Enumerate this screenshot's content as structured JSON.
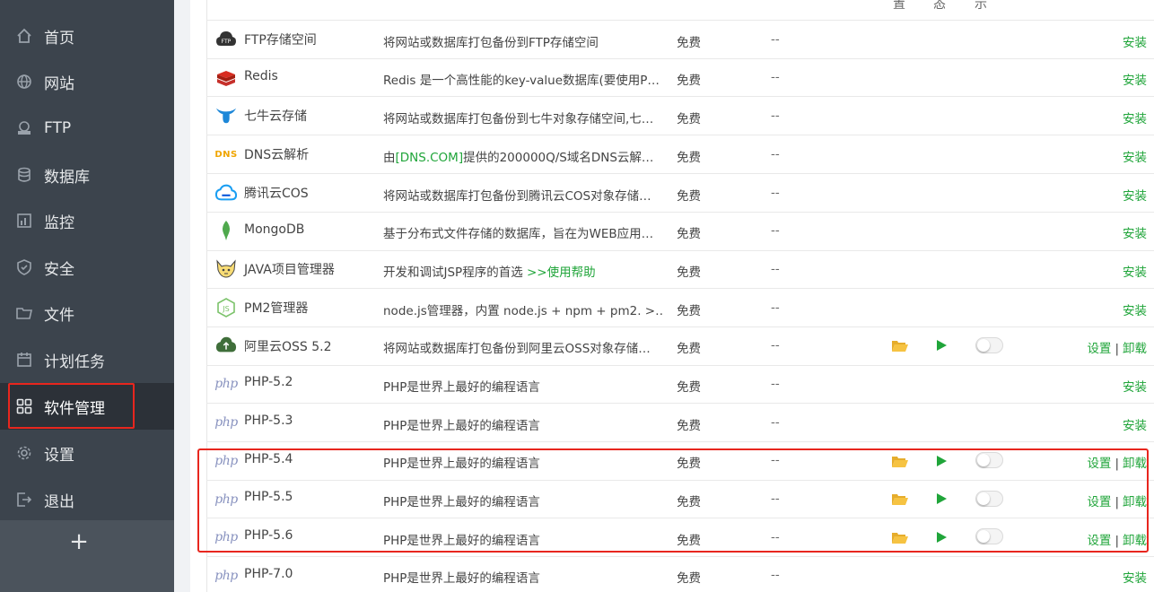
{
  "sidebar": {
    "items": [
      {
        "label": "首页",
        "icon": "home-icon"
      },
      {
        "label": "网站",
        "icon": "globe-icon"
      },
      {
        "label": "FTP",
        "icon": "ftp-icon"
      },
      {
        "label": "数据库",
        "icon": "database-icon"
      },
      {
        "label": "监控",
        "icon": "monitor-icon"
      },
      {
        "label": "安全",
        "icon": "shield-icon"
      },
      {
        "label": "文件",
        "icon": "folder-icon"
      },
      {
        "label": "计划任务",
        "icon": "calendar-icon"
      },
      {
        "label": "软件管理",
        "icon": "apps-grid-icon",
        "active": true
      },
      {
        "label": "设置",
        "icon": "gear-icon"
      },
      {
        "label": "退出",
        "icon": "logout-icon"
      }
    ],
    "add_label": "+"
  },
  "table": {
    "header_fragments": [
      "置",
      "态",
      "示"
    ],
    "rows": [
      {
        "name": "FTP存储空间",
        "icon": "ftp-cloud-icon",
        "desc": "将网站或数据库打包备份到FTP存储空间",
        "price": "免费",
        "expire": "--",
        "installed": false,
        "op": "安装"
      },
      {
        "name": "Redis",
        "icon": "redis-icon",
        "desc": "Redis 是一个高性能的key-value数据库(要使用P…",
        "price": "免费",
        "expire": "--",
        "installed": false,
        "op": "安装"
      },
      {
        "name": "七牛云存储",
        "icon": "qiniu-icon",
        "desc": "将网站或数据库打包备份到七牛对象存储空间,七…",
        "price": "免费",
        "expire": "--",
        "installed": false,
        "op": "安装"
      },
      {
        "name": "DNS云解析",
        "icon": "dns-icon",
        "desc_prefix": "由",
        "desc_link": "[DNS.COM]",
        "desc_suffix": "提供的200000Q/S域名DNS云解…",
        "price": "免费",
        "expire": "--",
        "installed": false,
        "op": "安装"
      },
      {
        "name": "腾讯云COS",
        "icon": "tencent-cloud-icon",
        "desc": "将网站或数据库打包备份到腾讯云COS对象存储…",
        "price": "免费",
        "expire": "--",
        "installed": false,
        "op": "安装"
      },
      {
        "name": "MongoDB",
        "icon": "mongodb-leaf-icon",
        "desc": "基于分布式文件存储的数据库，旨在为WEB应用…",
        "price": "免费",
        "expire": "--",
        "installed": false,
        "op": "安装"
      },
      {
        "name": "JAVA项目管理器",
        "icon": "tomcat-icon",
        "desc_prefix": "开发和调试JSP程序的首选 ",
        "desc_link": ">>使用帮助",
        "desc_suffix": "",
        "price": "免费",
        "expire": "--",
        "installed": false,
        "op": "安装"
      },
      {
        "name": "PM2管理器",
        "icon": "nodejs-icon",
        "desc": "node.js管理器，内置 node.js + npm + pm2. >…",
        "price": "免费",
        "expire": "--",
        "installed": false,
        "op": "安装"
      },
      {
        "name": "阿里云OSS 5.2",
        "icon": "aliyun-oss-icon",
        "desc": "将网站或数据库打包备份到阿里云OSS对象存储…",
        "price": "免费",
        "expire": "--",
        "installed": true,
        "op_settings": "设置",
        "op_sep": "|",
        "op_uninstall": "卸载"
      },
      {
        "name": "PHP-5.2",
        "icon": "php-icon",
        "desc": "PHP是世界上最好的编程语言",
        "price": "免费",
        "expire": "--",
        "installed": false,
        "op": "安装"
      },
      {
        "name": "PHP-5.3",
        "icon": "php-icon",
        "desc": "PHP是世界上最好的编程语言",
        "price": "免费",
        "expire": "--",
        "installed": false,
        "op": "安装"
      },
      {
        "name": "PHP-5.4",
        "icon": "php-icon",
        "desc": "PHP是世界上最好的编程语言",
        "price": "免费",
        "expire": "--",
        "installed": true,
        "op_settings": "设置",
        "op_sep": "|",
        "op_uninstall": "卸载"
      },
      {
        "name": "PHP-5.5",
        "icon": "php-icon",
        "desc": "PHP是世界上最好的编程语言",
        "price": "免费",
        "expire": "--",
        "installed": true,
        "op_settings": "设置",
        "op_sep": "|",
        "op_uninstall": "卸载"
      },
      {
        "name": "PHP-5.6",
        "icon": "php-icon",
        "desc": "PHP是世界上最好的编程语言",
        "price": "免费",
        "expire": "--",
        "installed": true,
        "op_settings": "设置",
        "op_sep": "|",
        "op_uninstall": "卸载"
      },
      {
        "name": "PHP-7.0",
        "icon": "php-icon",
        "desc": "PHP是世界上最好的编程语言",
        "price": "免费",
        "expire": "--",
        "installed": false,
        "op": "安装"
      }
    ],
    "php_logo_text": "php"
  },
  "colors": {
    "sidebar_bg": "#3c444d",
    "sidebar_active_bg": "#2c3138",
    "accent_green": "#20a53a",
    "highlight_red": "#e8261e",
    "folder_yellow": "#f6c342"
  }
}
